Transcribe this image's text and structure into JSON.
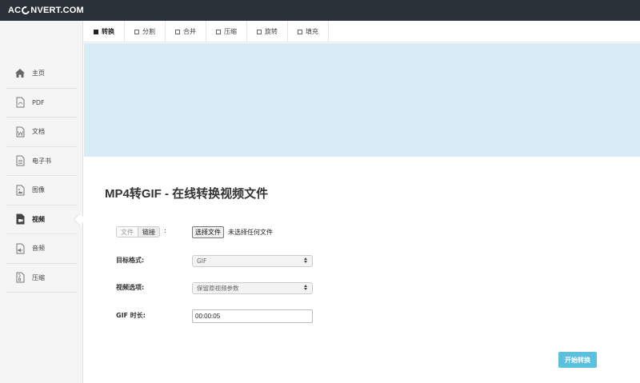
{
  "header": {
    "logo_left": "AC",
    "logo_right": "NVERT.COM"
  },
  "sidebar": {
    "items": [
      {
        "label": "主页",
        "icon": "home-icon"
      },
      {
        "label": "PDF",
        "icon": "pdf-file-icon"
      },
      {
        "label": "文档",
        "icon": "word-file-icon"
      },
      {
        "label": "电子书",
        "icon": "ebook-file-icon"
      },
      {
        "label": "图像",
        "icon": "image-file-icon"
      },
      {
        "label": "视频",
        "icon": "video-file-icon",
        "active": true
      },
      {
        "label": "音频",
        "icon": "audio-file-icon"
      },
      {
        "label": "压缩",
        "icon": "archive-file-icon"
      }
    ]
  },
  "tabs": [
    {
      "label": "转换",
      "active": true
    },
    {
      "label": "分割"
    },
    {
      "label": "合并"
    },
    {
      "label": "压缩"
    },
    {
      "label": "旋转"
    },
    {
      "label": "填充"
    }
  ],
  "main": {
    "title": "MP4转GIF - 在线转换视频文件",
    "source_toggle": {
      "file": "文件",
      "link": "链接",
      "colon": ":"
    },
    "file_button": "选择文件",
    "file_status": "未选择任何文件",
    "target_format": {
      "label": "目标格式:",
      "value": "GIF"
    },
    "video_options": {
      "label": "视频选项:",
      "value": "保留原视频参数"
    },
    "gif_duration": {
      "label": "GIF 时长:",
      "value": "00:00:05"
    },
    "start_button": "开始转换"
  },
  "colors": {
    "topbar": "#2b3139",
    "banner": "#d9ebf7",
    "accent": "#5bc0de",
    "sidebar": "#f5f5f5"
  }
}
